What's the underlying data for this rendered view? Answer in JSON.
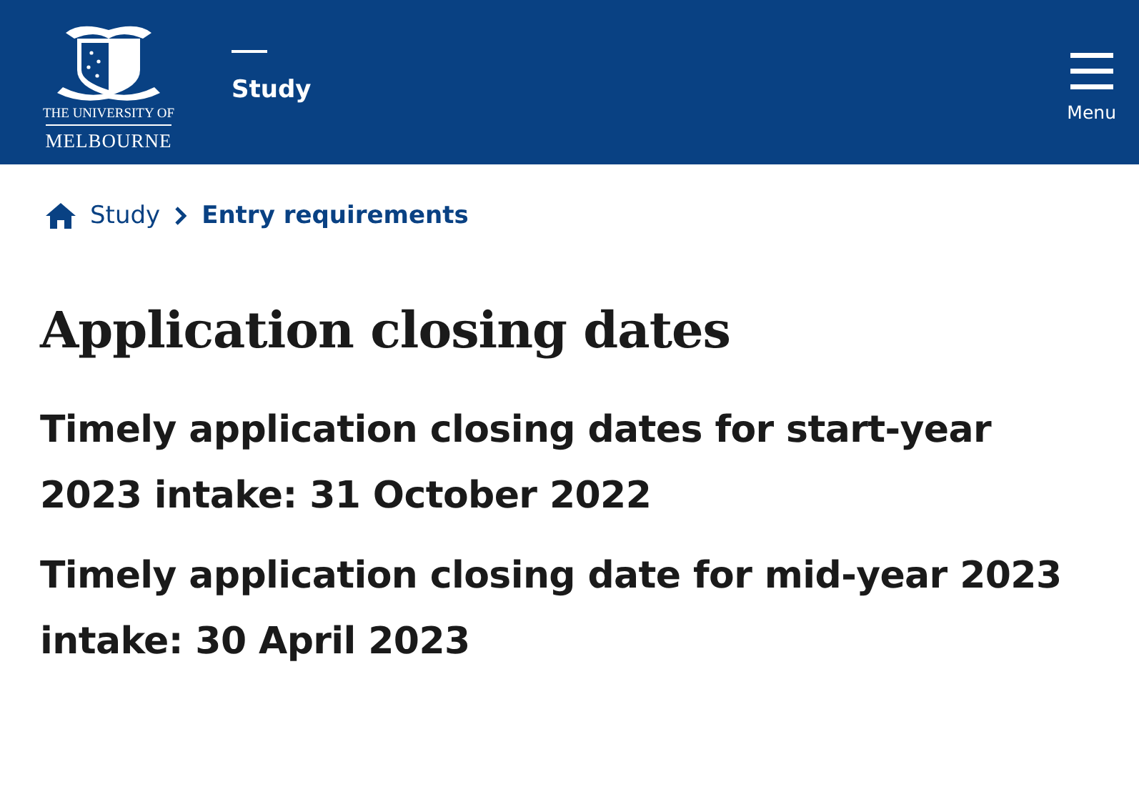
{
  "header": {
    "logo": {
      "line_1": "THE UNIVERSITY OF",
      "line_2": "MELBOURNE"
    },
    "section": "Study",
    "menu": {
      "label": "Menu"
    }
  },
  "breadcrumbs": [
    {
      "label": "Study",
      "current": false
    },
    {
      "label": "Entry requirements",
      "current": true
    }
  ],
  "title": "Application closing dates",
  "subheadings": [
    "Timely application closing dates for start-year 2023 intake: 31 October 2022",
    "Timely application closing date for mid-year 2023 intake: 30 April 2023"
  ]
}
